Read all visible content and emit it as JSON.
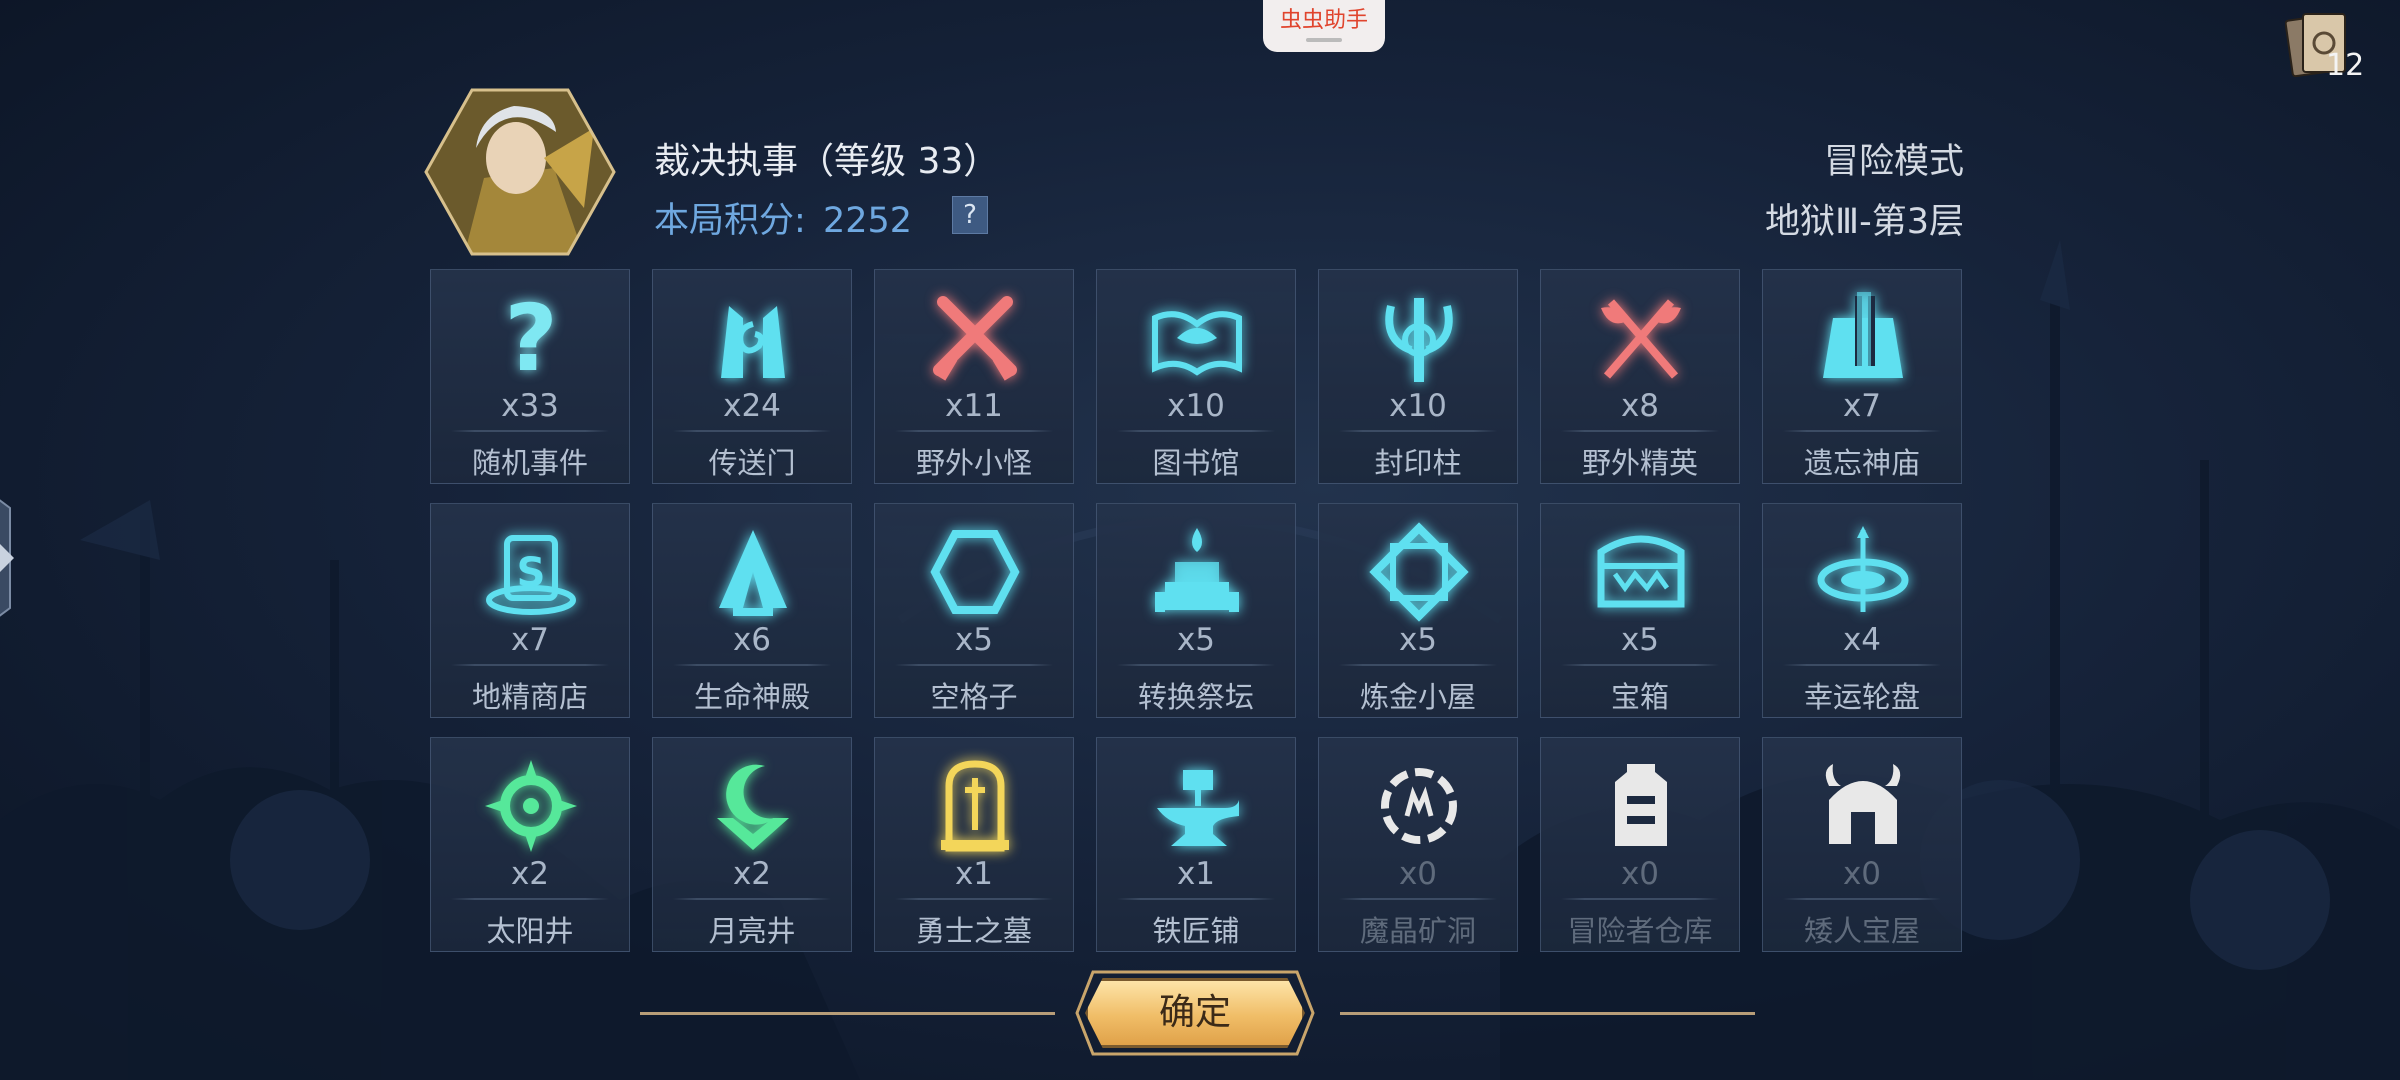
{
  "top_tab": {
    "label": "虫虫助手"
  },
  "deck": {
    "count": "12"
  },
  "header": {
    "hero_name": "裁决执事（等级 33）",
    "score_label": "本局积分:",
    "score_value": "2252",
    "help_label": "?",
    "mode": "冒险模式",
    "level": "地狱Ⅲ-第3层"
  },
  "tiles": [
    {
      "count": "x33",
      "label": "随机事件",
      "icon": "question-icon",
      "color": "#7fe8f2"
    },
    {
      "count": "x24",
      "label": "传送门",
      "icon": "portal-icon",
      "color": "#5fe0f0"
    },
    {
      "count": "x11",
      "label": "野外小怪",
      "icon": "crossed-swords-icon",
      "color": "#f07a7a"
    },
    {
      "count": "x10",
      "label": "图书馆",
      "icon": "book-icon",
      "color": "#5fe0f0"
    },
    {
      "count": "x10",
      "label": "封印柱",
      "icon": "seal-pillar-icon",
      "color": "#5fe0f0"
    },
    {
      "count": "x8",
      "label": "野外精英",
      "icon": "crossed-axes-icon",
      "color": "#f07a7a"
    },
    {
      "count": "x7",
      "label": "遗忘神庙",
      "icon": "temple-icon",
      "color": "#5fe0f0"
    },
    {
      "count": "x7",
      "label": "地精商店",
      "icon": "shop-hat-icon",
      "color": "#5fe0f0"
    },
    {
      "count": "x6",
      "label": "生命神殿",
      "icon": "life-shrine-icon",
      "color": "#5fe0f0"
    },
    {
      "count": "x5",
      "label": "空格子",
      "icon": "hexagon-icon",
      "color": "#5fe0f0"
    },
    {
      "count": "x5",
      "label": "转换祭坛",
      "icon": "altar-icon",
      "color": "#5fe0f0"
    },
    {
      "count": "x5",
      "label": "炼金小屋",
      "icon": "alchemy-icon",
      "color": "#5fe0f0"
    },
    {
      "count": "x5",
      "label": "宝箱",
      "icon": "chest-icon",
      "color": "#5fe0f0"
    },
    {
      "count": "x4",
      "label": "幸运轮盘",
      "icon": "wheel-icon",
      "color": "#5fe0f0"
    },
    {
      "count": "x2",
      "label": "太阳井",
      "icon": "sun-well-icon",
      "color": "#56e89a"
    },
    {
      "count": "x2",
      "label": "月亮井",
      "icon": "moon-well-icon",
      "color": "#56e89a"
    },
    {
      "count": "x1",
      "label": "勇士之墓",
      "icon": "tomb-icon",
      "color": "#f3d65a"
    },
    {
      "count": "x1",
      "label": "铁匠铺",
      "icon": "anvil-icon",
      "color": "#5fe0f0"
    },
    {
      "count": "x0",
      "label": "魔晶矿洞",
      "icon": "crystal-mine-icon",
      "color": "#e8e8e8"
    },
    {
      "count": "x0",
      "label": "冒险者仓库",
      "icon": "warehouse-icon",
      "color": "#e8e8e8"
    },
    {
      "count": "x0",
      "label": "矮人宝屋",
      "icon": "dwarf-helmet-icon",
      "color": "#e8e8e8"
    }
  ],
  "confirm": {
    "label": "确定"
  }
}
